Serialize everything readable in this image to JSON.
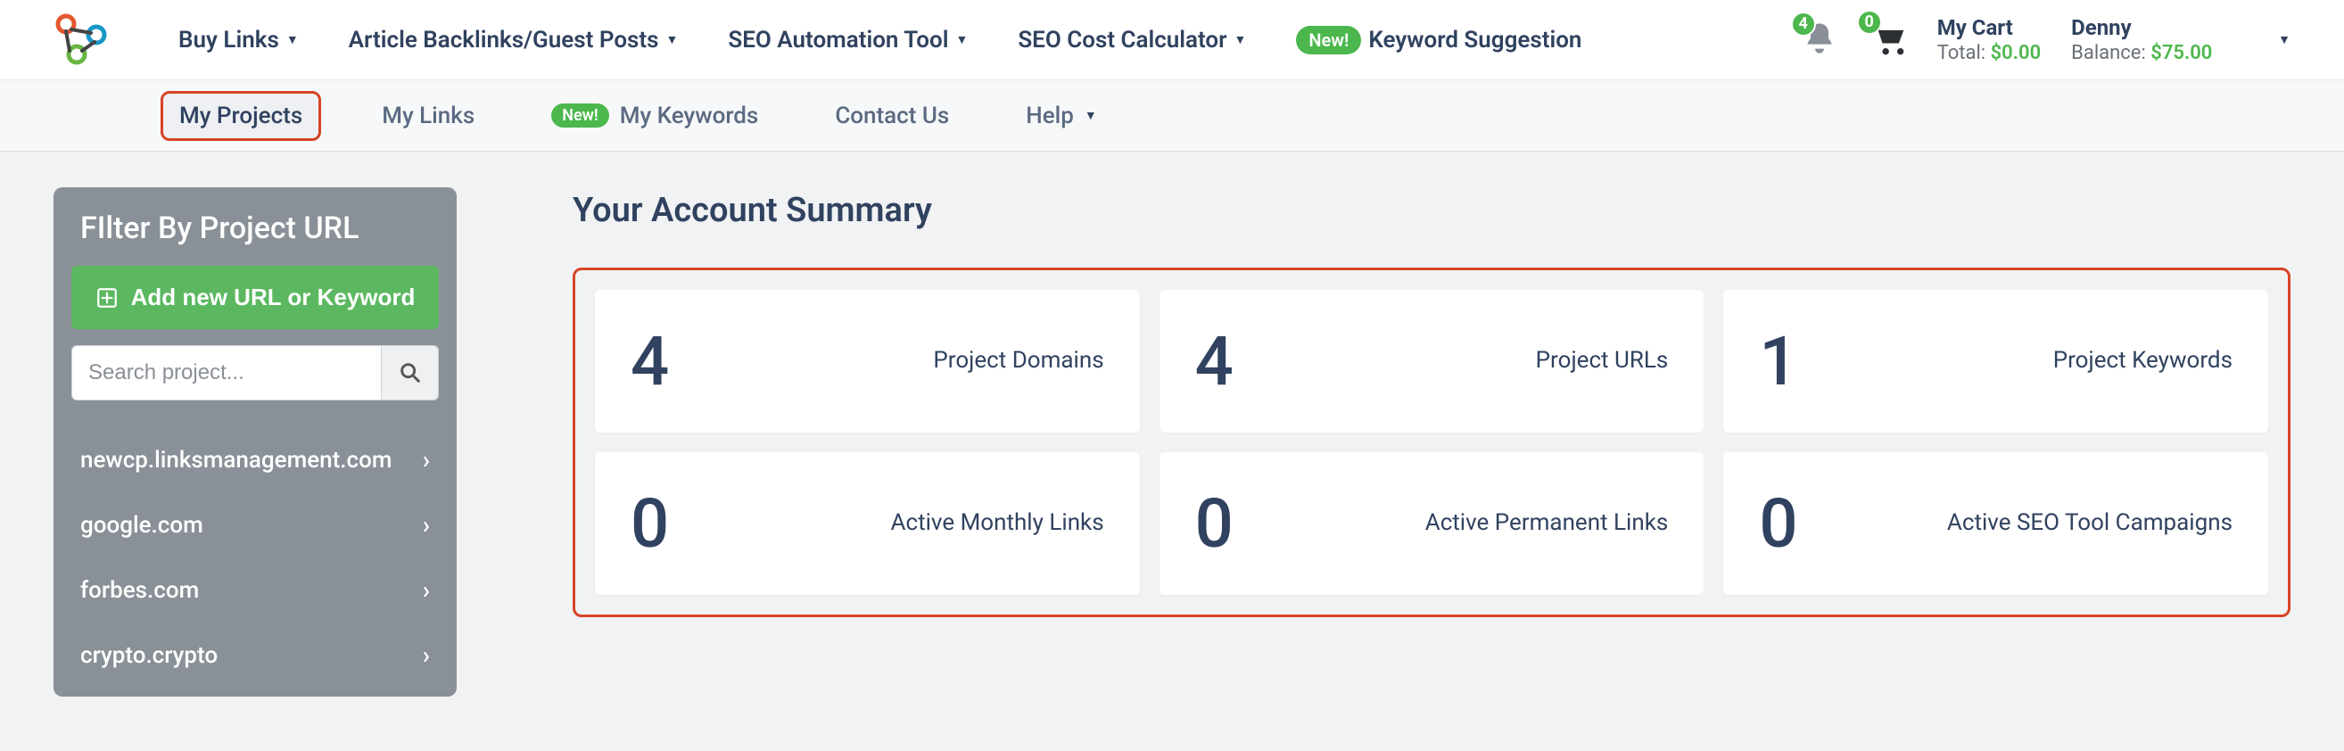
{
  "topnav": {
    "items": [
      {
        "label": "Buy Links",
        "has_caret": true
      },
      {
        "label": "Article Backlinks/Guest Posts",
        "has_caret": true
      },
      {
        "label": "SEO Automation Tool",
        "has_caret": true
      },
      {
        "label": "SEO Cost Calculator",
        "has_caret": true
      }
    ],
    "keyword_suggestion": {
      "badge": "New!",
      "label": "Keyword Suggestion"
    }
  },
  "header_right": {
    "notifications_count": "4",
    "cart_count": "0",
    "cart": {
      "title": "My Cart",
      "total_label": "Total:",
      "total_value": "$0.00"
    },
    "user": {
      "name": "Denny",
      "balance_label": "Balance:",
      "balance_value": "$75.00"
    }
  },
  "subnav": {
    "items": [
      {
        "label": "My Projects",
        "active": true
      },
      {
        "label": "My Links"
      },
      {
        "badge": "New!",
        "label": "My Keywords"
      },
      {
        "label": "Contact Us"
      },
      {
        "label": "Help",
        "has_caret": true
      }
    ]
  },
  "sidebar": {
    "title": "FIlter By Project URL",
    "add_button": "Add new URL or Keyword",
    "search_placeholder": "Search project...",
    "projects": [
      "newcp.linksmanagement.com",
      "google.com",
      "forbes.com",
      "crypto.crypto"
    ]
  },
  "content": {
    "heading": "Your Account Summary",
    "stats": [
      {
        "value": "4",
        "label": "Project Domains"
      },
      {
        "value": "4",
        "label": "Project URLs"
      },
      {
        "value": "1",
        "label": "Project Keywords"
      },
      {
        "value": "0",
        "label": "Active Monthly Links"
      },
      {
        "value": "0",
        "label": "Active Permanent Links"
      },
      {
        "value": "0",
        "label": "Active SEO Tool Campaigns"
      }
    ]
  }
}
